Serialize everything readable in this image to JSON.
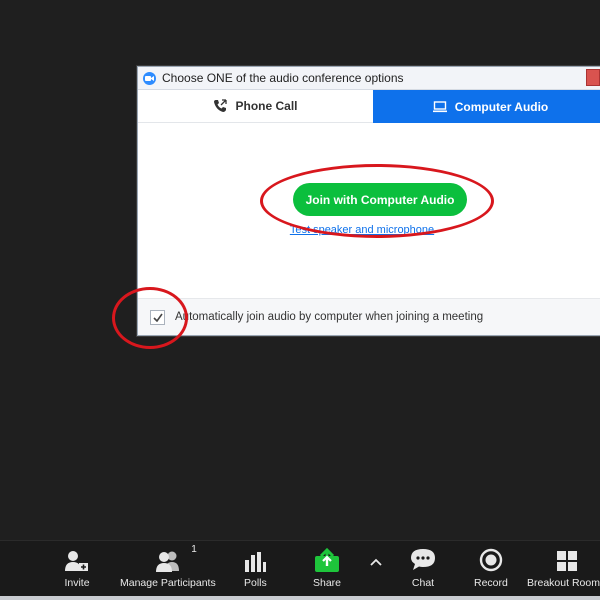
{
  "dialog": {
    "title": "Choose ONE of the audio conference options",
    "tabs": [
      {
        "label": "Phone Call",
        "icon": "phone-icon",
        "active": false
      },
      {
        "label": "Computer Audio",
        "icon": "monitor-icon",
        "active": true
      }
    ],
    "join_button": "Join with Computer Audio",
    "test_link": "Test speaker and microphone",
    "auto_join_checkbox": {
      "label": "Automatically join audio by computer when joining a meeting",
      "checked": true
    }
  },
  "toolbar": {
    "items": [
      {
        "label": "Invite",
        "icon": "invite-icon"
      },
      {
        "label": "Manage Participants",
        "icon": "participants-icon",
        "count": "1"
      },
      {
        "label": "Polls",
        "icon": "polls-icon"
      },
      {
        "label": "Share",
        "icon": "share-icon"
      },
      {
        "label": "Chat",
        "icon": "chat-icon"
      },
      {
        "label": "Record",
        "icon": "record-icon"
      },
      {
        "label": "Breakout Rooms",
        "icon": "breakout-rooms-icon"
      }
    ]
  },
  "colors": {
    "accent_blue": "#0e71eb",
    "join_green": "#0bbf3d",
    "share_green": "#1ec53b",
    "annotation_red": "#d8171d",
    "background": "#1f1f1f"
  }
}
